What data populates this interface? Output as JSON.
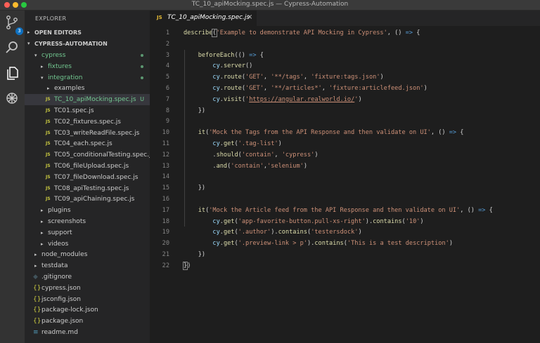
{
  "window": {
    "title": "TC_10_apiMocking.spec.js — Cypress-Automation"
  },
  "activity_bar": {
    "icons": [
      "source-control-icon",
      "search-icon",
      "explorer-icon",
      "debug-icon"
    ],
    "source_control_badge": "3"
  },
  "sidebar": {
    "title": "EXPLORER",
    "open_editors_label": "OPEN EDITORS",
    "project_label": "CYPRESS-AUTOMATION",
    "tree": [
      {
        "label": "cypress",
        "indent": 1,
        "arrow": "▾",
        "folder": true,
        "status": "dot",
        "color": "#73c991"
      },
      {
        "label": "fixtures",
        "indent": 2,
        "arrow": "▸",
        "folder": true,
        "status": "dot",
        "color": "#73c991"
      },
      {
        "label": "integration",
        "indent": 2,
        "arrow": "▾",
        "folder": true,
        "status": "dot",
        "color": "#73c991"
      },
      {
        "label": "examples",
        "indent": 3,
        "arrow": "▸",
        "folder": true,
        "status": "",
        "color": "#cccccc"
      },
      {
        "label": "TC_10_apiMocking.spec.js",
        "indent": 3,
        "icon": "JS",
        "status": "U",
        "color": "#73c991",
        "selected": true
      },
      {
        "label": "TC01.spec.js",
        "indent": 3,
        "icon": "JS",
        "status": "",
        "color": "#cccccc"
      },
      {
        "label": "TC02_fixtures.spec.js",
        "indent": 3,
        "icon": "JS",
        "status": "",
        "color": "#cccccc"
      },
      {
        "label": "TC03_writeReadFile.spec.js",
        "indent": 3,
        "icon": "JS",
        "status": "",
        "color": "#cccccc"
      },
      {
        "label": "TC04_each.spec.js",
        "indent": 3,
        "icon": "JS",
        "status": "",
        "color": "#cccccc"
      },
      {
        "label": "TC05_conditionalTesting.spec.js",
        "indent": 3,
        "icon": "JS",
        "status": "",
        "color": "#cccccc"
      },
      {
        "label": "TC06_fileUpload.spec.js",
        "indent": 3,
        "icon": "JS",
        "status": "",
        "color": "#cccccc"
      },
      {
        "label": "TC07_fileDownload.spec.js",
        "indent": 3,
        "icon": "JS",
        "status": "",
        "color": "#cccccc"
      },
      {
        "label": "TC08_apiTesting.spec.js",
        "indent": 3,
        "icon": "JS",
        "status": "",
        "color": "#cccccc"
      },
      {
        "label": "TC09_apiChaining.spec.js",
        "indent": 3,
        "icon": "JS",
        "status": "",
        "color": "#cccccc"
      },
      {
        "label": "plugins",
        "indent": 2,
        "arrow": "▸",
        "folder": true,
        "status": "",
        "color": "#cccccc"
      },
      {
        "label": "screenshots",
        "indent": 2,
        "arrow": "▸",
        "folder": true,
        "status": "",
        "color": "#cccccc"
      },
      {
        "label": "support",
        "indent": 2,
        "arrow": "▸",
        "folder": true,
        "status": "",
        "color": "#cccccc"
      },
      {
        "label": "videos",
        "indent": 2,
        "arrow": "▸",
        "folder": true,
        "status": "",
        "color": "#cccccc"
      },
      {
        "label": "node_modules",
        "indent": 1,
        "arrow": "▸",
        "folder": true,
        "status": "",
        "color": "#cccccc"
      },
      {
        "label": "testdata",
        "indent": 1,
        "arrow": "▸",
        "folder": true,
        "status": "",
        "color": "#cccccc"
      },
      {
        "label": ".gitignore",
        "indent": 1,
        "icon": "◆",
        "status": "",
        "color": "#cccccc"
      },
      {
        "label": "cypress.json",
        "indent": 1,
        "icon": "{}",
        "status": "",
        "color": "#cccccc"
      },
      {
        "label": "jsconfig.json",
        "indent": 1,
        "icon": "{}",
        "status": "",
        "color": "#cccccc"
      },
      {
        "label": "package-lock.json",
        "indent": 1,
        "icon": "{}",
        "status": "",
        "color": "#cccccc"
      },
      {
        "label": "package.json",
        "indent": 1,
        "icon": "{}",
        "status": "",
        "color": "#cccccc"
      },
      {
        "label": "readme.md",
        "indent": 1,
        "icon": "≡",
        "status": "",
        "color": "#cccccc"
      }
    ]
  },
  "editor": {
    "tab": {
      "badge": "JS",
      "name": "TC_10_apiMocking.spec.js",
      "close": "×"
    },
    "lines": [
      [
        [
          "call",
          "describe"
        ],
        [
          "bracket",
          "("
        ],
        [
          "str",
          "'Example to demonstrate API Mocking in Cypress'"
        ],
        [
          "plain",
          ", () "
        ],
        [
          "kw",
          "=>"
        ],
        [
          "plain",
          " {"
        ]
      ],
      [],
      [
        [
          "plain",
          "    "
        ],
        [
          "call",
          "beforeEach"
        ],
        [
          "plain",
          "(() "
        ],
        [
          "kw",
          "=>"
        ],
        [
          "plain",
          " {"
        ]
      ],
      [
        [
          "plain",
          "        "
        ],
        [
          "var",
          "cy"
        ],
        [
          "plain",
          "."
        ],
        [
          "call",
          "server"
        ],
        [
          "plain",
          "()"
        ]
      ],
      [
        [
          "plain",
          "        "
        ],
        [
          "var",
          "cy"
        ],
        [
          "plain",
          "."
        ],
        [
          "call",
          "route"
        ],
        [
          "plain",
          "("
        ],
        [
          "str",
          "'GET'"
        ],
        [
          "plain",
          ", "
        ],
        [
          "str",
          "'**/tags'"
        ],
        [
          "plain",
          ", "
        ],
        [
          "str",
          "'fixture:tags.json'"
        ],
        [
          "plain",
          ")"
        ]
      ],
      [
        [
          "plain",
          "        "
        ],
        [
          "var",
          "cy"
        ],
        [
          "plain",
          "."
        ],
        [
          "call",
          "route"
        ],
        [
          "plain",
          "("
        ],
        [
          "str",
          "'GET'"
        ],
        [
          "plain",
          ", "
        ],
        [
          "str",
          "'**/articles*'"
        ],
        [
          "plain",
          ", "
        ],
        [
          "str",
          "'fixture:articlefeed.json'"
        ],
        [
          "plain",
          ")"
        ]
      ],
      [
        [
          "plain",
          "        "
        ],
        [
          "var",
          "cy"
        ],
        [
          "plain",
          "."
        ],
        [
          "call",
          "visit"
        ],
        [
          "plain",
          "("
        ],
        [
          "str",
          "'"
        ],
        [
          "url",
          "https://angular.realworld.io/"
        ],
        [
          "str",
          "'"
        ],
        [
          "plain",
          ")"
        ]
      ],
      [
        [
          "plain",
          "    })"
        ]
      ],
      [],
      [
        [
          "plain",
          "    "
        ],
        [
          "call",
          "it"
        ],
        [
          "plain",
          "("
        ],
        [
          "str",
          "'Mock the Tags from the API Response and then validate on UI'"
        ],
        [
          "plain",
          ", () "
        ],
        [
          "kw",
          "=>"
        ],
        [
          "plain",
          " {"
        ]
      ],
      [
        [
          "plain",
          "        "
        ],
        [
          "var",
          "cy"
        ],
        [
          "plain",
          "."
        ],
        [
          "call",
          "get"
        ],
        [
          "plain",
          "("
        ],
        [
          "str",
          "'.tag-list'"
        ],
        [
          "plain",
          ")"
        ]
      ],
      [
        [
          "plain",
          "        ."
        ],
        [
          "call",
          "should"
        ],
        [
          "plain",
          "("
        ],
        [
          "str",
          "'contain'"
        ],
        [
          "plain",
          ", "
        ],
        [
          "str",
          "'cypress'"
        ],
        [
          "plain",
          ")"
        ]
      ],
      [
        [
          "plain",
          "        ."
        ],
        [
          "call",
          "and"
        ],
        [
          "plain",
          "("
        ],
        [
          "str",
          "'contain'"
        ],
        [
          "plain",
          ","
        ],
        [
          "str",
          "'selenium'"
        ],
        [
          "plain",
          ")"
        ]
      ],
      [],
      [
        [
          "plain",
          "    })"
        ]
      ],
      [],
      [
        [
          "plain",
          "    "
        ],
        [
          "call",
          "it"
        ],
        [
          "plain",
          "("
        ],
        [
          "str",
          "'Mock the Article feed from the API Response and then validate on UI'"
        ],
        [
          "plain",
          ", () "
        ],
        [
          "kw",
          "=>"
        ],
        [
          "plain",
          " {"
        ]
      ],
      [
        [
          "plain",
          "        "
        ],
        [
          "var",
          "cy"
        ],
        [
          "plain",
          "."
        ],
        [
          "call",
          "get"
        ],
        [
          "plain",
          "("
        ],
        [
          "str",
          "'app-favorite-button.pull-xs-right'"
        ],
        [
          "plain",
          ")."
        ],
        [
          "call",
          "contains"
        ],
        [
          "plain",
          "("
        ],
        [
          "str",
          "'10'"
        ],
        [
          "plain",
          ")"
        ]
      ],
      [
        [
          "plain",
          "        "
        ],
        [
          "var",
          "cy"
        ],
        [
          "plain",
          "."
        ],
        [
          "call",
          "get"
        ],
        [
          "plain",
          "("
        ],
        [
          "str",
          "'.author'"
        ],
        [
          "plain",
          ")."
        ],
        [
          "call",
          "contains"
        ],
        [
          "plain",
          "("
        ],
        [
          "str",
          "'testersdock'"
        ],
        [
          "plain",
          ")"
        ]
      ],
      [
        [
          "plain",
          "        "
        ],
        [
          "var",
          "cy"
        ],
        [
          "plain",
          "."
        ],
        [
          "call",
          "get"
        ],
        [
          "plain",
          "("
        ],
        [
          "str",
          "'.preview-link > p'"
        ],
        [
          "plain",
          ")."
        ],
        [
          "call",
          "contains"
        ],
        [
          "plain",
          "("
        ],
        [
          "str",
          "'This is a test description'"
        ],
        [
          "plain",
          ")"
        ]
      ],
      [
        [
          "plain",
          "    })"
        ]
      ],
      [
        [
          "bracket",
          "}"
        ],
        [
          "plain",
          ")"
        ]
      ]
    ]
  }
}
